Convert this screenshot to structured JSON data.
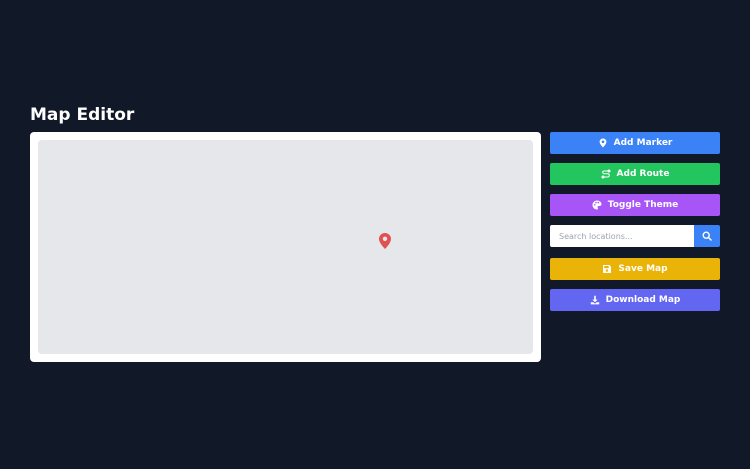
{
  "page": {
    "title": "Map Editor"
  },
  "map": {
    "marker_icon": "map-pin-icon",
    "marker_color": "#e05252"
  },
  "sidebar": {
    "add_marker": {
      "label": "Add Marker",
      "icon": "map-pin-icon",
      "color": "#3b82f6"
    },
    "add_route": {
      "label": "Add Route",
      "icon": "route-icon",
      "color": "#22c55e"
    },
    "toggle_theme": {
      "label": "Toggle Theme",
      "icon": "palette-icon",
      "color": "#a855f7"
    },
    "search": {
      "value": "",
      "placeholder": "Search locations...",
      "icon": "search-icon",
      "color": "#3b82f6"
    },
    "save_map": {
      "label": "Save Map",
      "icon": "save-icon",
      "color": "#eab308"
    },
    "download_map": {
      "label": "Download Map",
      "icon": "download-icon",
      "color": "#6366f1"
    }
  }
}
